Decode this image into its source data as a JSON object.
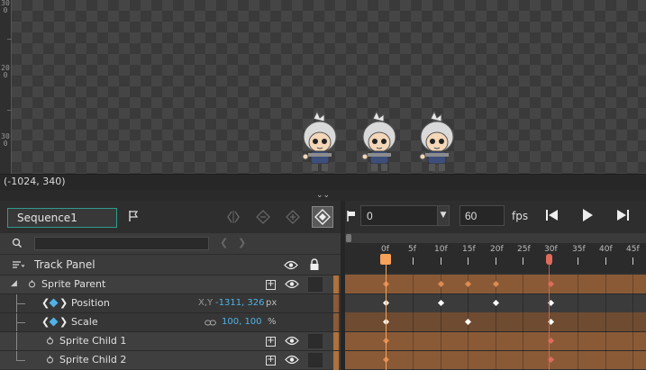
{
  "viewport": {
    "ruler_labels": [
      "300",
      "200",
      "300"
    ],
    "sprites": [
      "sprite-1",
      "sprite-2",
      "sprite-3"
    ]
  },
  "status": {
    "cursor_coords": "(-1024, 340)"
  },
  "sequence": {
    "tab_label": "Sequence1"
  },
  "track_panel": {
    "search_placeholder": "",
    "header_label": "Track Panel",
    "rows": [
      {
        "label": "Sprite Parent",
        "type": "parent"
      },
      {
        "label": "Position",
        "type": "prop",
        "value_prefix": "X,Y",
        "value": "-1311, 326",
        "unit": "px"
      },
      {
        "label": "Scale",
        "type": "prop",
        "value": "100, 100",
        "unit": "%"
      },
      {
        "label": "Sprite Child 1",
        "type": "child"
      },
      {
        "label": "Sprite Child 2",
        "type": "child"
      }
    ]
  },
  "timeline": {
    "current_frame": "0",
    "fps_value": "60",
    "fps_label": "fps",
    "frame_labels": [
      "0f",
      "5f",
      "10f",
      "15f",
      "20f",
      "25f",
      "30f",
      "35f",
      "40f",
      "45f"
    ]
  },
  "colors": {
    "accent": "#2f9c8a",
    "track_orange": "#8a5a37",
    "keyframe_marker": "#e06b5a",
    "playhead": "#f5a25a",
    "value_blue": "#4fb3e8"
  }
}
